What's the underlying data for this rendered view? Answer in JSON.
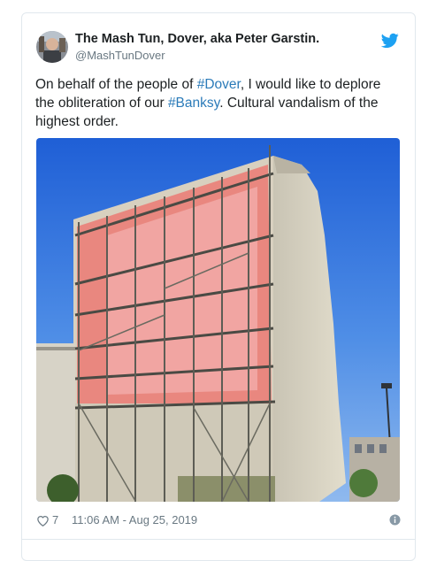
{
  "author": {
    "display_name": "The Mash Tun, Dover, aka Peter Garstin.",
    "handle": "@MashTunDover"
  },
  "tweet": {
    "text_1": "On behalf of the people of ",
    "hashtag_1": "#Dover",
    "text_2": ", I would like to deplore the obliteration of our ",
    "hashtag_2": "#Banksy",
    "text_3": ". Cultural vandalism of the highest order."
  },
  "footer": {
    "like_count": "7",
    "timestamp": "11:06 AM - Aug 25, 2019"
  },
  "icons": {
    "brand": "twitter-bird-icon",
    "like": "heart-icon",
    "info": "info-icon"
  },
  "colors": {
    "link": "#2b7bb9",
    "brand": "#1da1f2",
    "muted": "#697882",
    "text": "#1c2022",
    "border": "#e1e8ed"
  }
}
